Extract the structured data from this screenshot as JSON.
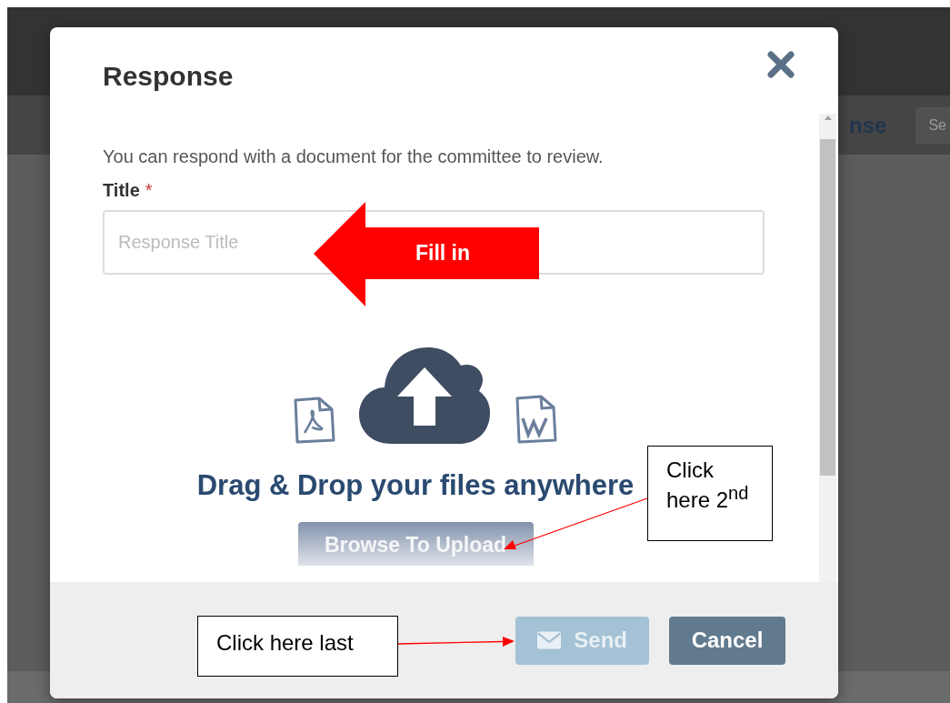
{
  "background": {
    "header_text": "nse",
    "button_text": "Se"
  },
  "dialog": {
    "title": "Response",
    "description": "You can respond with a document for the committee to review.",
    "title_field": {
      "label": "Title",
      "required_mark": "*",
      "placeholder": "Response Title"
    },
    "drop_zone": {
      "text": "Drag & Drop your files anywhere",
      "browse_button": "Browse To Upload"
    },
    "buttons": [
      {
        "label": "Send",
        "kind": "send",
        "disabled": true
      },
      {
        "label": "Cancel",
        "kind": "cancel",
        "disabled": false
      }
    ]
  },
  "annotations": [
    {
      "kind": "block-arrow",
      "text": "Fill in"
    },
    {
      "kind": "callout",
      "text": "Click here 2$^{nd}$"
    },
    {
      "kind": "callout",
      "text": "Click here last"
    }
  ]
}
